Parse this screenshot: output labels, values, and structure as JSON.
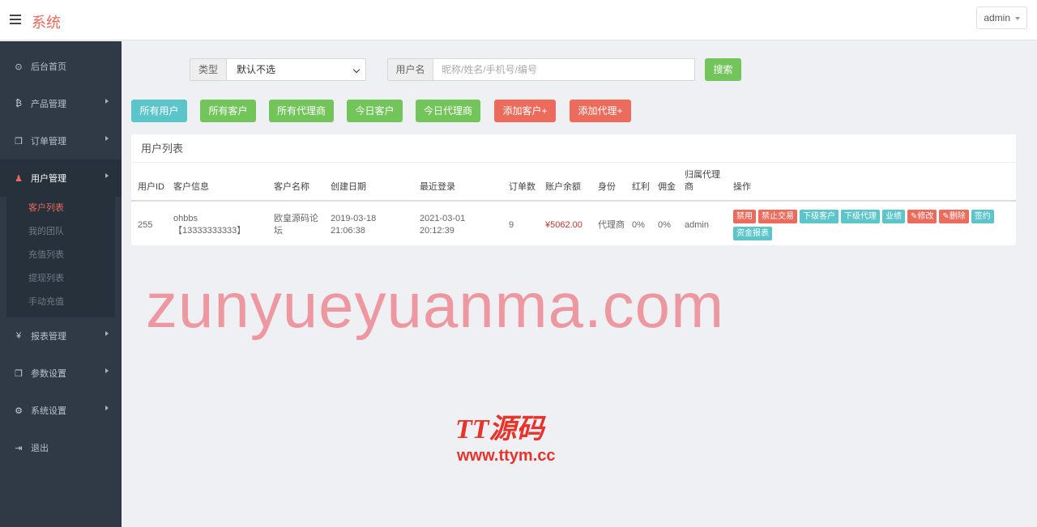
{
  "header": {
    "brand": "系统",
    "user": "admin"
  },
  "sidebar": {
    "items": [
      {
        "label": "后台首页",
        "icon": "dashboard-icon",
        "glyph": "⊙"
      },
      {
        "label": "产品管理",
        "icon": "bitcoin-icon",
        "glyph": "₿"
      },
      {
        "label": "订单管理",
        "icon": "copy-icon",
        "glyph": "❐"
      },
      {
        "label": "用户管理",
        "icon": "user-icon",
        "glyph": "♟"
      },
      {
        "label": "报表管理",
        "icon": "yen-icon",
        "glyph": "¥"
      },
      {
        "label": "参数设置",
        "icon": "copy-icon",
        "glyph": "❐"
      },
      {
        "label": "系统设置",
        "icon": "cogs-icon",
        "glyph": "⚙"
      },
      {
        "label": "退出",
        "icon": "sign-out-icon",
        "glyph": "⇥"
      }
    ],
    "sub_items": [
      "客户列表",
      "我的团队",
      "充值列表",
      "提现列表",
      "手动充值"
    ]
  },
  "filters": {
    "type_label": "类型",
    "type_value": "默认不选",
    "user_label": "用户名",
    "user_placeholder": "昵称/姓名/手机号/编号",
    "search_button": "搜索"
  },
  "actions": [
    "所有用户",
    "所有客户",
    "所有代理商",
    "今日客户",
    "今日代理商",
    "添加客户+",
    "添加代理+"
  ],
  "table": {
    "title": "用户列表",
    "columns": [
      "用户ID",
      "客户信息",
      "客户名称",
      "创建日期",
      "最近登录",
      "订单数",
      "账户余额",
      "身份",
      "红利",
      "佣金",
      "归属代理商",
      "操作"
    ],
    "rows": [
      {
        "id": "255",
        "info_name": "ohbbs",
        "info_phone": "【13333333333】",
        "customer_name": "欧皇源码论坛",
        "created": "2019-03-18 21:06:38",
        "last_login": "2021-03-01 20:12:39",
        "orders": "9",
        "balance": "¥5062.00",
        "role": "代理商",
        "bonus": "0%",
        "commission": "0%",
        "agent": "admin",
        "ops": [
          "禁用",
          "禁止交易",
          "下级客户",
          "下级代理",
          "业绩",
          "修改",
          "删除",
          "签约",
          "资金报表"
        ]
      }
    ]
  },
  "watermarks": {
    "big": "zunyueyuanma.com",
    "logo": "TT源码",
    "url": "www.ttym.cc"
  }
}
